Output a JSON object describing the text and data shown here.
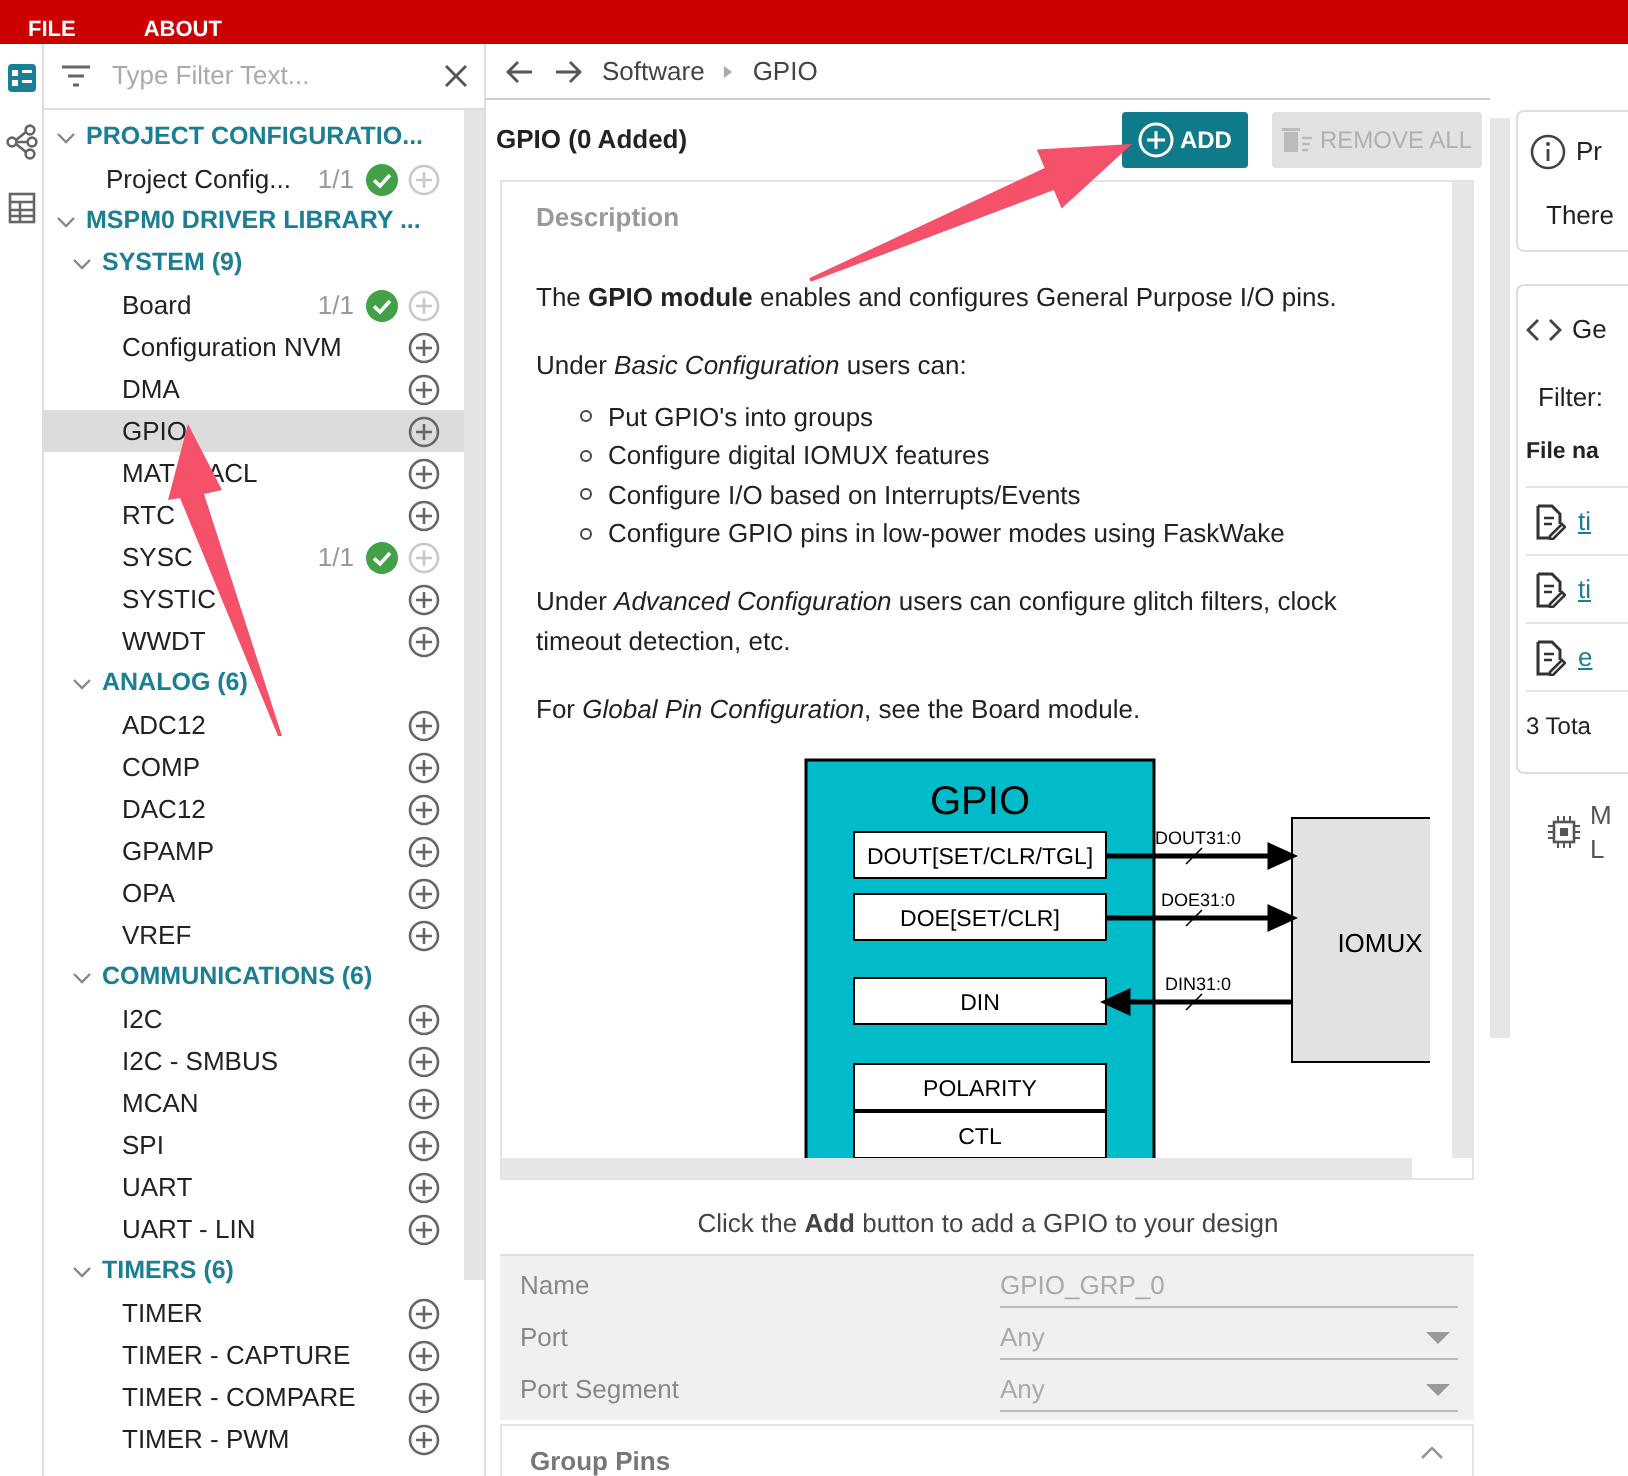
{
  "menu": [
    {
      "label": "FILE"
    },
    {
      "label": "ABOUT"
    }
  ],
  "filter": {
    "placeholder": "Type Filter Text..."
  },
  "tree": [
    {
      "kind": "root",
      "label": "PROJECT CONFIGURATIO...",
      "expanded": true,
      "children": [
        {
          "kind": "module",
          "label": "Project Config...",
          "count": "1/1",
          "added": true,
          "selected": false
        }
      ]
    },
    {
      "kind": "root",
      "label": "MSPM0 DRIVER LIBRARY ...",
      "expanded": true,
      "children": [
        {
          "kind": "group",
          "label": "SYSTEM (9)",
          "expanded": true,
          "children": [
            {
              "kind": "module",
              "label": "Board",
              "count": "1/1",
              "added": true,
              "selected": false
            },
            {
              "kind": "module",
              "label": "Configuration NVM",
              "added": false,
              "selected": false
            },
            {
              "kind": "module",
              "label": "DMA",
              "added": false,
              "selected": false
            },
            {
              "kind": "module",
              "label": "GPIO",
              "added": false,
              "selected": true
            },
            {
              "kind": "module",
              "label": "MAT",
              "label_tail": "ACL",
              "added": false,
              "selected": false
            },
            {
              "kind": "module",
              "label": "RTC",
              "added": false,
              "selected": false
            },
            {
              "kind": "module",
              "label": "SYSC",
              "count": "1/1",
              "added": true,
              "selected": false
            },
            {
              "kind": "module",
              "label": "SYSTIC",
              "added": false,
              "selected": false
            },
            {
              "kind": "module",
              "label": "WWDT",
              "added": false,
              "selected": false
            }
          ]
        },
        {
          "kind": "group",
          "label": "ANALOG (6)",
          "expanded": true,
          "children": [
            {
              "kind": "module",
              "label": "ADC12",
              "added": false,
              "selected": false
            },
            {
              "kind": "module",
              "label": "COMP",
              "added": false,
              "selected": false
            },
            {
              "kind": "module",
              "label": "DAC12",
              "added": false,
              "selected": false
            },
            {
              "kind": "module",
              "label": "GPAMP",
              "added": false,
              "selected": false
            },
            {
              "kind": "module",
              "label": "OPA",
              "added": false,
              "selected": false
            },
            {
              "kind": "module",
              "label": "VREF",
              "added": false,
              "selected": false
            }
          ]
        },
        {
          "kind": "group",
          "label": "COMMUNICATIONS (6)",
          "expanded": true,
          "children": [
            {
              "kind": "module",
              "label": "I2C",
              "added": false,
              "selected": false
            },
            {
              "kind": "module",
              "label": "I2C - SMBUS",
              "added": false,
              "selected": false
            },
            {
              "kind": "module",
              "label": "MCAN",
              "added": false,
              "selected": false
            },
            {
              "kind": "module",
              "label": "SPI",
              "added": false,
              "selected": false
            },
            {
              "kind": "module",
              "label": "UART",
              "added": false,
              "selected": false
            },
            {
              "kind": "module",
              "label": "UART - LIN",
              "added": false,
              "selected": false
            }
          ]
        },
        {
          "kind": "group",
          "label": "TIMERS (6)",
          "expanded": true,
          "children": [
            {
              "kind": "module",
              "label": "TIMER",
              "added": false,
              "selected": false
            },
            {
              "kind": "module",
              "label": "TIMER - CAPTURE",
              "added": false,
              "selected": false
            },
            {
              "kind": "module",
              "label": "TIMER - COMPARE",
              "added": false,
              "selected": false
            },
            {
              "kind": "module",
              "label": "TIMER - PWM",
              "added": false,
              "selected": false
            }
          ]
        }
      ]
    }
  ],
  "breadcrumb": [
    "Software",
    "GPIO"
  ],
  "module_title": "GPIO (0 Added)",
  "buttons": [
    {
      "kind": "add",
      "label": "ADD",
      "disabled": false
    },
    {
      "kind": "remove",
      "label": "REMOVE ALL",
      "disabled": true
    }
  ],
  "description": {
    "heading": "Description",
    "blocks": [
      {
        "kind": "para",
        "text": "The **GPIO module** enables and configures General Purpose I/O pins."
      },
      {
        "kind": "para",
        "text": "Under *Basic Configuration* users can:"
      },
      {
        "kind": "list",
        "items": [
          "Put GPIO's into groups",
          "Configure digital IOMUX features",
          "Configure I/O based on Interrupts/Events",
          "Configure GPIO pins in low-power modes using FaskWake"
        ]
      },
      {
        "kind": "para",
        "text": "Under *Advanced Configuration* users can configure glitch filters, clock timeout detection, etc."
      },
      {
        "kind": "para",
        "text": "For *Global Pin Configuration*, see the Board module."
      }
    ]
  },
  "diagram": {
    "title": "GPIO",
    "target": "IOMUX",
    "registers": [
      {
        "label": "DOUT[SET/CLR/TGL]",
        "signal": "DOUT31:0",
        "kind": "output"
      },
      {
        "label": "DOE[SET/CLR]",
        "signal": "DOE31:0",
        "kind": "output"
      },
      {
        "label": "DIN",
        "signal": "DIN31:0",
        "kind": "input"
      },
      {
        "label": "POLARITY"
      },
      {
        "label": "CTL"
      }
    ]
  },
  "hint": "Click the **Add** button to add a GPIO to your design",
  "fields": [
    {
      "kind": "text",
      "label": "Name",
      "value": "GPIO_GRP_0",
      "disabled": true
    },
    {
      "kind": "select",
      "label": "Port",
      "value": "Any",
      "disabled": true
    },
    {
      "kind": "select",
      "label": "Port Segment",
      "value": "Any",
      "disabled": true
    }
  ],
  "section": {
    "label": "Group Pins",
    "expanded": true
  },
  "right_panel": {
    "problems": {
      "title": "Pr",
      "text": "There"
    },
    "generated": {
      "title": "Ge",
      "filter": "Filter:",
      "column": "File na",
      "files": [
        "ti",
        "ti",
        "e"
      ],
      "total": "3 Tota"
    },
    "device": {
      "lines": [
        "M",
        "L"
      ]
    }
  }
}
